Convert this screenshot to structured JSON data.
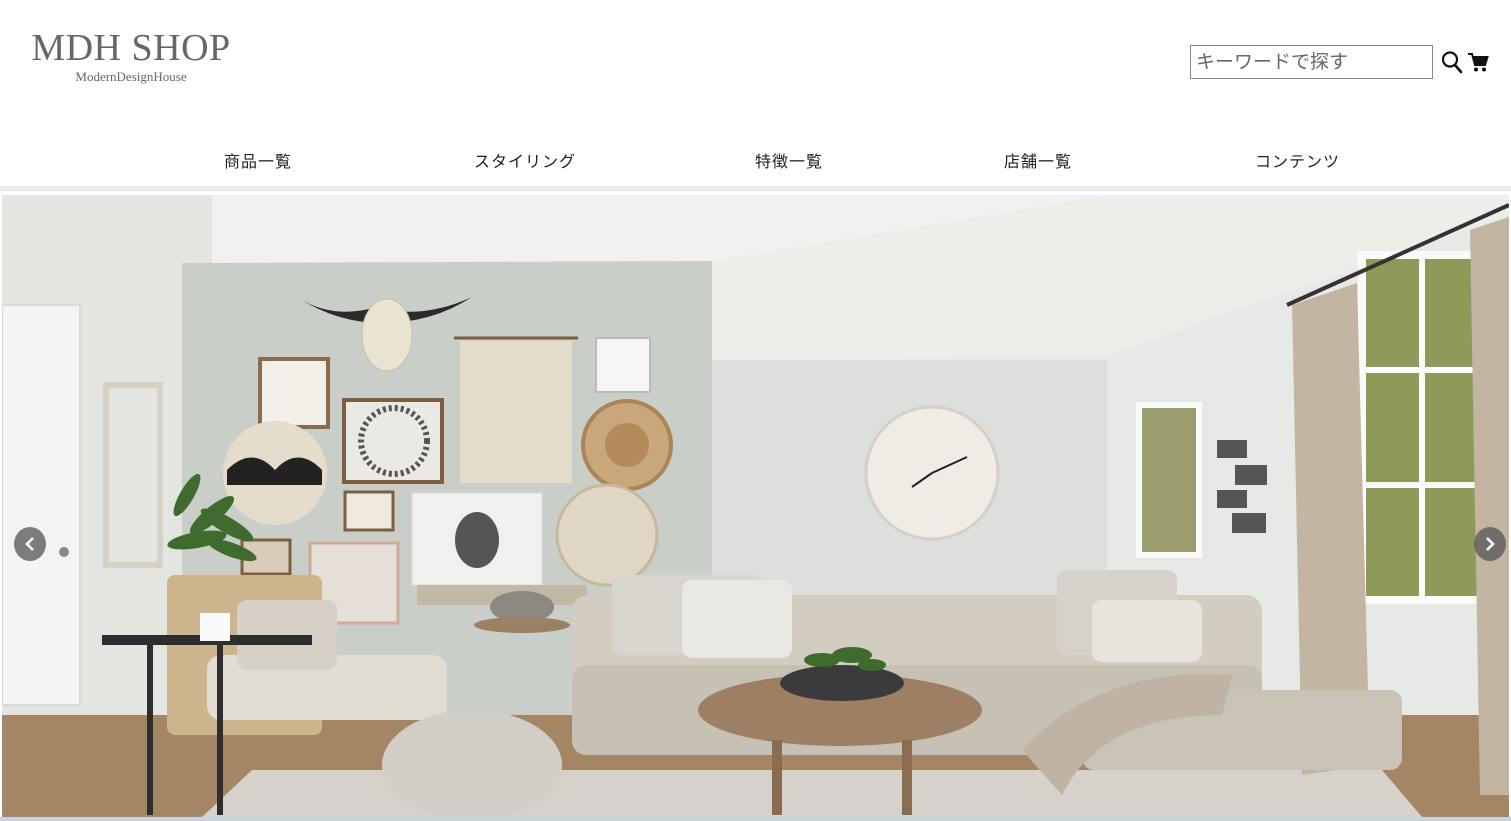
{
  "logo": {
    "title": "MDH SHOP",
    "subtitle": "ModernDesignHouse"
  },
  "search": {
    "placeholder": "キーワードで探す",
    "value": ""
  },
  "icons": {
    "search": "search-icon",
    "cart": "cart-icon",
    "prev": "chevron-left-icon",
    "next": "chevron-right-icon"
  },
  "nav": {
    "items": [
      {
        "label": "商品一覧"
      },
      {
        "label": "スタイリング"
      },
      {
        "label": "特徴一覧"
      },
      {
        "label": "店舗一覧"
      },
      {
        "label": "コンテンツ"
      }
    ]
  },
  "colors": {
    "logo": "#666666",
    "nav_text": "#222222",
    "divider": "#ececec",
    "carousel_button": "#5a5a5a"
  }
}
